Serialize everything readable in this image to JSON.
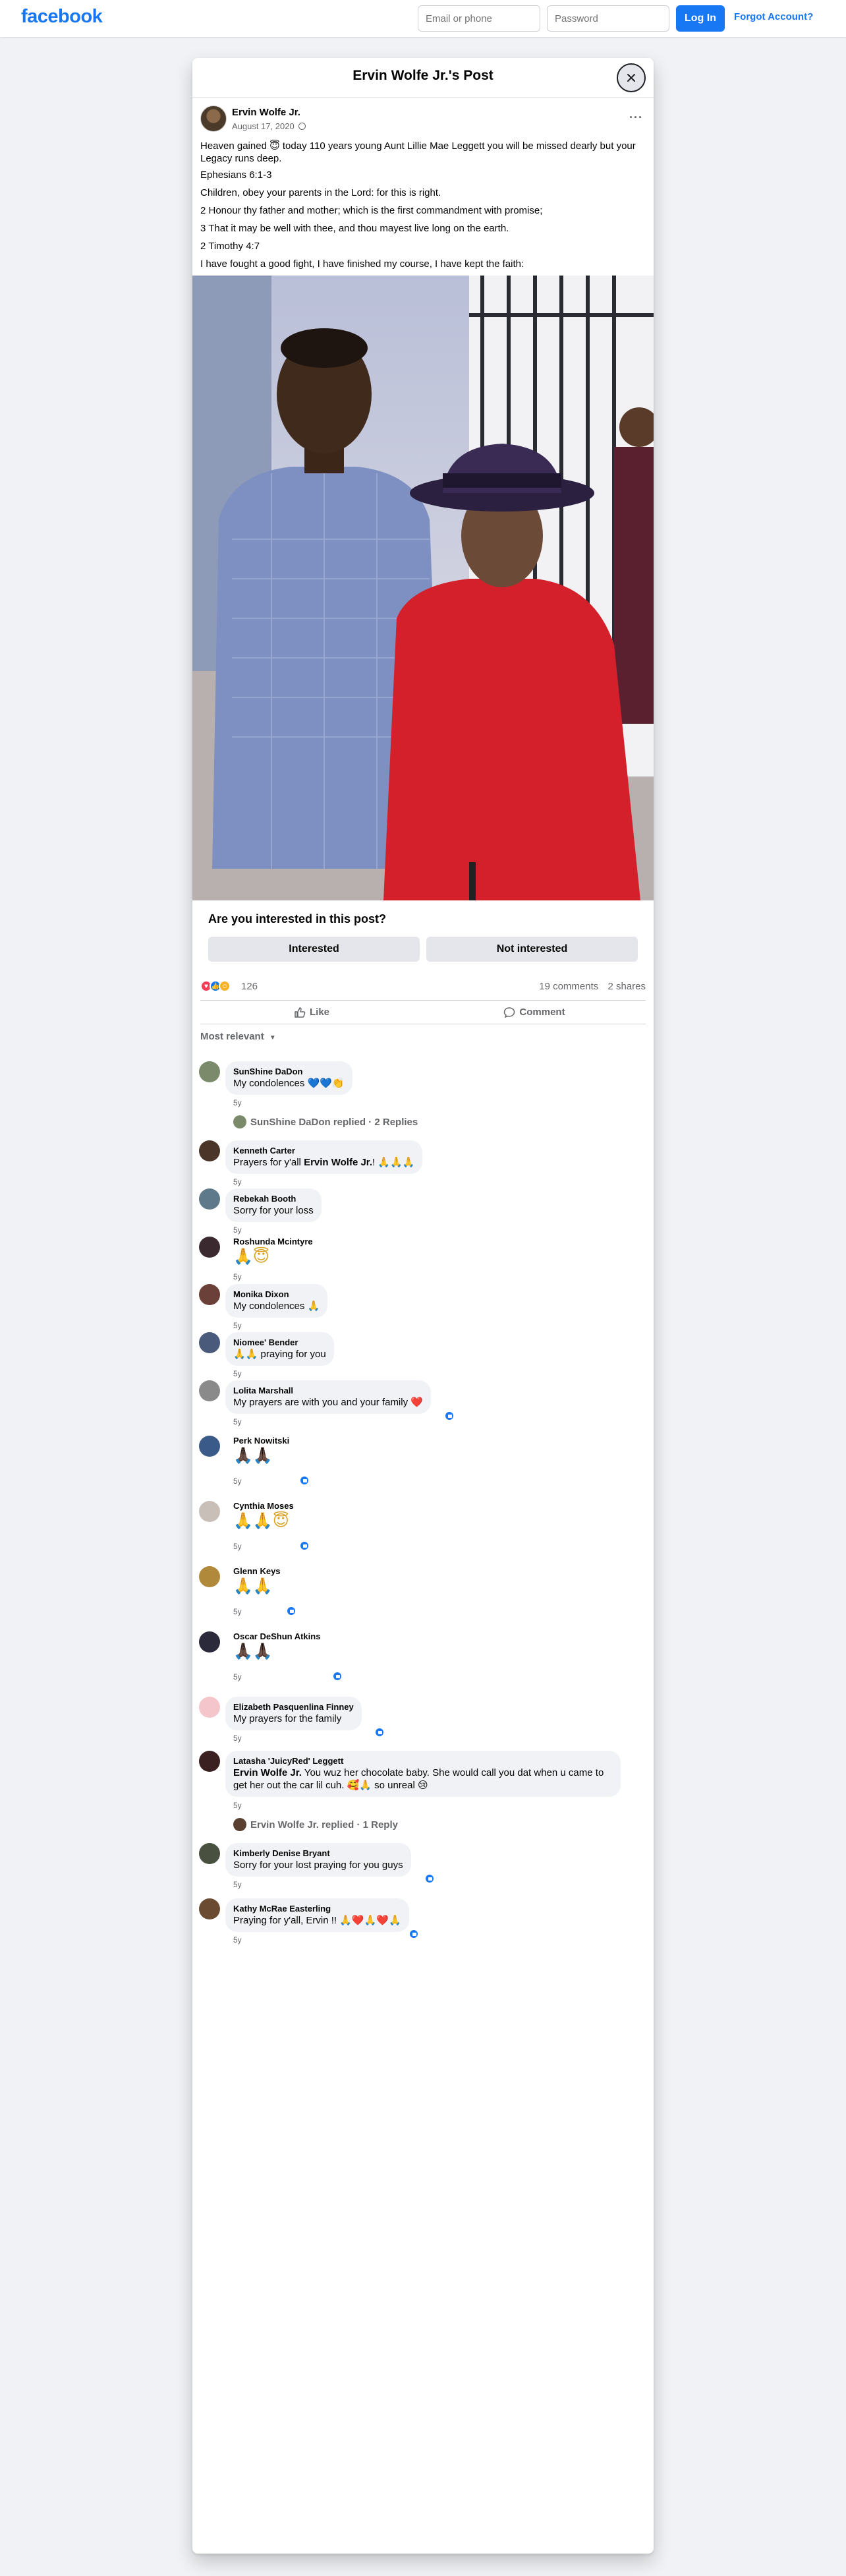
{
  "topbar": {
    "logo": "facebook",
    "email_placeholder": "Email or phone",
    "password_placeholder": "Password",
    "login_label": "Log In",
    "forgot_label": "Forgot Account?"
  },
  "dialog": {
    "title": "Ervin Wolfe Jr.'s Post"
  },
  "post": {
    "author": "Ervin Wolfe Jr.",
    "date": "August 17, 2020",
    "paragraphs": [
      "Heaven gained 😇 today 110 years young Aunt Lillie Mae Leggett you will be missed dearly  but your Legacy runs deep.",
      "Ephesians 6:1-3",
      "Children, obey your parents in the Lord: for this is right.",
      "2 Honour thy father and mother; which is the first commandment with promise;",
      "3 That it may be well with thee, and thou mayest live long on the earth.",
      "2 Timothy 4:7",
      "I have fought a good fight, I have finished my course, I have kept the faith:"
    ]
  },
  "interest": {
    "question": "Are you interested in this post?",
    "interested": "Interested",
    "not_interested": "Not interested"
  },
  "stats": {
    "reactions": "126",
    "comments": "19 comments",
    "shares": "2 shares"
  },
  "actions": {
    "like": "Like",
    "comment": "Comment"
  },
  "sort_label": "Most relevant",
  "colors": {
    "brand": "#1877f2",
    "reaction_love": "#f33e58",
    "reaction_care": "#f7b125"
  },
  "comments": [
    {
      "name": "SunShine DaDon",
      "text": "My condolences 💙💙👏",
      "time": "5y"
    },
    {
      "reply": "SunShine DaDon replied · 2 Replies"
    },
    {
      "name": "Kenneth Carter",
      "text_pre": "Prayers for y'all ",
      "tag": "Ervin Wolfe Jr.",
      "text_post": "! 🙏🙏🙏",
      "time": "5y"
    },
    {
      "name": "Rebekah Booth",
      "text": "Sorry for your loss",
      "time": "5y"
    },
    {
      "name": "Roshunda Mcintyre",
      "text": "🙏😇",
      "time": "5y"
    },
    {
      "name": "Monika Dixon",
      "text": "My condolences 🙏",
      "time": "5y"
    },
    {
      "name": "Niomee' Bender",
      "text": "🙏🙏 praying for you",
      "time": "5y"
    },
    {
      "name": "Lolita Marshall",
      "text": "My prayers are with you and your family ❤️",
      "time": "5y"
    },
    {
      "name": "Perk Nowitski",
      "text": "🙏🏿🙏🏿",
      "time": "5y"
    },
    {
      "name": "Cynthia Moses",
      "text": "🙏🙏😇",
      "time": "5y"
    },
    {
      "name": "Glenn Keys",
      "text": "🙏🙏",
      "time": "5y"
    },
    {
      "name": "Oscar DeShun Atkins",
      "text": "🙏🏿🙏🏿",
      "time": "5y"
    },
    {
      "name": "Elizabeth Pasquenlina Finney",
      "text": "My prayers for the family",
      "time": "5y"
    },
    {
      "name": "Latasha 'JuicyRed' Leggett",
      "tag": "Ervin Wolfe Jr.",
      "text_post": " You wuz her chocolate baby. She would call you dat when u came to get her out the car lil cuh. 🥰🙏 so unreal 😢",
      "time": "5y"
    },
    {
      "reply": "Ervin Wolfe Jr. replied · 1 Reply"
    },
    {
      "name": "Kimberly Denise Bryant",
      "text": "Sorry for your lost praying for you guys",
      "time": "5y"
    },
    {
      "name": "Kathy McRae Easterling",
      "text": "Praying for y'all, Ervin !! 🙏❤️🙏❤️🙏",
      "time": "5y"
    }
  ]
}
